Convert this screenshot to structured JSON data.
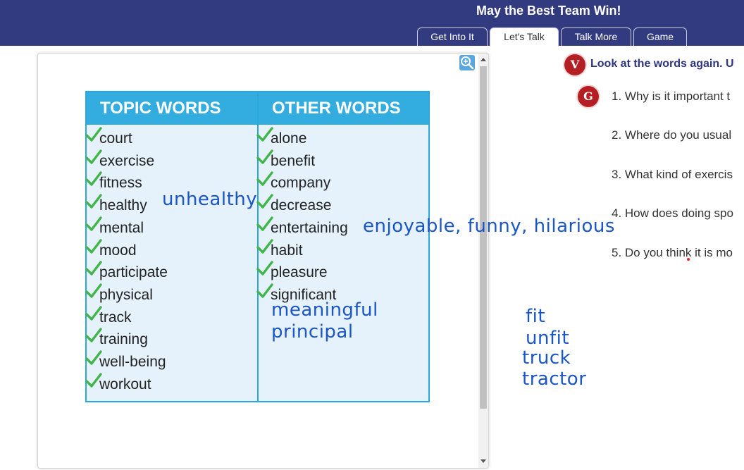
{
  "header": {
    "title": "May the Best Team Win!",
    "tabs": [
      {
        "label": "Get Into It",
        "active": false
      },
      {
        "label": "Let's Talk",
        "active": true
      },
      {
        "label": "Talk More",
        "active": false
      },
      {
        "label": "Game",
        "active": false
      }
    ],
    "colors": {
      "bar": "#323b80",
      "text": "#ffffff"
    }
  },
  "panel": {
    "zoom_icon": "zoom-in-icon",
    "table": {
      "topic_header": "TOPIC WORDS",
      "other_header": "OTHER WORDS",
      "topic_words": [
        "court",
        "exercise",
        "fitness",
        "healthy",
        "mental",
        "mood",
        "participate",
        "physical",
        "track",
        "training",
        "well-being",
        "workout"
      ],
      "other_words": [
        "alone",
        "benefit",
        "company",
        "decrease",
        "entertaining",
        "habit",
        "pleasure",
        "significant"
      ],
      "colors": {
        "border": "#2aa7dd",
        "header_bg": "#33ace0",
        "body_bg": "#e6f2fb",
        "check": "#3fb54a"
      }
    }
  },
  "annotations": {
    "unhealthy": "unhealthy",
    "enjoyable": "enjoyable, funny, hilarious",
    "meaningful": "meaningful",
    "principal": "principal",
    "fit": "fit",
    "unfit": "unfit",
    "truck": "truck",
    "tractor": "tractor",
    "ink_color": "#1a55c9"
  },
  "right": {
    "v_badge": "V",
    "g_badge": "G",
    "instruction": "Look at the words again. U",
    "questions": [
      "1. Why is it important t",
      "2. Where do you usual",
      "3. What kind of exercis",
      "4. How does doing spo",
      "5. Do you think it is mo"
    ]
  }
}
